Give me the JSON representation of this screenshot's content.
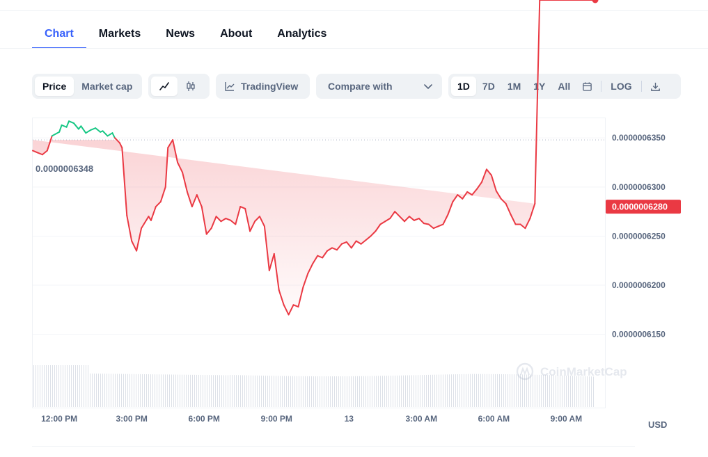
{
  "tabs": [
    {
      "label": "Chart",
      "active": true
    },
    {
      "label": "Markets",
      "active": false
    },
    {
      "label": "News",
      "active": false
    },
    {
      "label": "About",
      "active": false
    },
    {
      "label": "Analytics",
      "active": false
    }
  ],
  "toolbar": {
    "metric": [
      "Price",
      "Market cap"
    ],
    "metric_active": "Price",
    "chart_style_icons": [
      "line-chart-icon",
      "candlestick-icon"
    ],
    "tradingview_label": "TradingView",
    "compare_label": "Compare with",
    "ranges": [
      "1D",
      "7D",
      "1M",
      "1Y",
      "All"
    ],
    "range_active": "1D",
    "log_label": "LOG",
    "calendar_icon": "calendar-icon",
    "download_icon": "download-icon"
  },
  "chart_data": {
    "type": "line",
    "x_tick_labels": [
      "12:00 PM",
      "3:00 PM",
      "6:00 PM",
      "9:00 PM",
      "13",
      "3:00 AM",
      "6:00 AM",
      "9:00 AM"
    ],
    "y_tick_labels": [
      "0.0000006350",
      "0.0000006300",
      "0.0000006250",
      "0.0000006200",
      "0.0000006150"
    ],
    "ylim": [
      6.12e-07,
      6.37e-07
    ],
    "reference_value": 6.348e-07,
    "reference_label": "0.0000006348",
    "current_value": 6.28e-07,
    "current_label": "0.0000006280",
    "currency": "USD",
    "watermark": "CoinMarketCap",
    "up_color": "#16c784",
    "down_color": "#ea3943",
    "x_range_hours": [
      10.9,
      34.2
    ],
    "series": [
      {
        "x_hours": [
          10.9,
          11.1,
          11.3,
          11.5,
          11.7,
          12.0,
          12.1,
          12.3,
          12.4,
          12.6,
          12.8,
          12.9,
          13.1,
          13.3,
          13.5,
          13.7,
          13.8,
          14.0,
          14.2,
          14.3,
          14.5,
          14.6,
          14.8,
          15.0,
          15.2,
          15.4,
          15.5,
          15.7,
          15.8,
          16.0,
          16.2,
          16.4,
          16.5,
          16.7,
          16.9,
          17.1,
          17.3,
          17.5,
          17.7,
          17.9,
          18.1,
          18.3,
          18.5,
          18.7,
          18.9,
          19.1,
          19.3,
          19.5,
          19.7,
          19.9,
          20.1,
          20.3,
          20.5,
          20.7,
          20.9,
          21.1,
          21.3,
          21.5,
          21.7,
          21.9,
          22.1,
          22.3,
          22.5,
          22.7,
          22.9,
          23.1,
          23.3,
          23.5,
          23.7,
          23.9,
          24.1,
          24.3,
          24.5,
          24.7,
          24.9,
          25.1,
          25.3,
          25.5,
          25.7,
          25.9,
          26.1,
          26.3,
          26.5,
          26.7,
          26.9,
          27.1,
          27.3,
          27.5,
          27.7,
          27.9,
          28.1,
          28.3,
          28.5,
          28.7,
          28.9,
          29.1,
          29.3,
          29.5,
          29.7,
          29.9,
          30.1,
          30.3,
          30.5,
          30.7,
          30.9,
          31.1,
          31.3,
          31.5,
          31.7,
          31.9,
          32.1,
          32.3,
          32.5,
          32.7,
          32.9,
          33.1,
          33.3,
          33.5,
          33.7,
          33.9,
          34.1,
          34.2
        ],
        "y": [
          6.337e-07,
          6.335e-07,
          6.333e-07,
          6.337e-07,
          6.352e-07,
          6.356e-07,
          6.363e-07,
          6.361e-07,
          6.367e-07,
          6.365e-07,
          6.359e-07,
          6.362e-07,
          6.355e-07,
          6.358e-07,
          6.36e-07,
          6.356e-07,
          6.357e-07,
          6.352e-07,
          6.355e-07,
          6.35e-07,
          6.345e-07,
          6.34e-07,
          6.271e-07,
          6.245e-07,
          6.235e-07,
          6.258e-07,
          6.262e-07,
          6.27e-07,
          6.266e-07,
          6.28e-07,
          6.285e-07,
          6.3e-07,
          6.34e-07,
          6.348e-07,
          6.325e-07,
          6.315e-07,
          6.295e-07,
          6.28e-07,
          6.292e-07,
          6.28e-07,
          6.252e-07,
          6.258e-07,
          6.27e-07,
          6.265e-07,
          6.268e-07,
          6.266e-07,
          6.262e-07,
          6.28e-07,
          6.278e-07,
          6.255e-07,
          6.265e-07,
          6.27e-07,
          6.26e-07,
          6.215e-07,
          6.232e-07,
          6.195e-07,
          6.18e-07,
          6.17e-07,
          6.18e-07,
          6.178e-07,
          6.198e-07,
          6.212e-07,
          6.222e-07,
          6.23e-07,
          6.228e-07,
          6.235e-07,
          6.238e-07,
          6.236e-07,
          6.242e-07,
          6.244e-07,
          6.238e-07,
          6.245e-07,
          6.242e-07,
          6.246e-07,
          6.25e-07,
          6.255e-07,
          6.262e-07,
          6.265e-07,
          6.268e-07,
          6.275e-07,
          6.27e-07,
          6.265e-07,
          6.27e-07,
          6.266e-07,
          6.268e-07,
          6.263e-07,
          6.262e-07,
          6.258e-07,
          6.26e-07,
          6.262e-07,
          6.272e-07,
          6.285e-07,
          6.292e-07,
          6.288e-07,
          6.295e-07,
          6.292e-07,
          6.298e-07,
          6.305e-07,
          6.318e-07,
          6.312e-07,
          6.296e-07,
          6.288e-07,
          6.283e-07,
          6.272e-07,
          6.262e-07,
          6.262e-07,
          6.258e-07,
          6.268e-07,
          6.283e-07
        ],
        "volume_level": 0.55
      }
    ]
  }
}
